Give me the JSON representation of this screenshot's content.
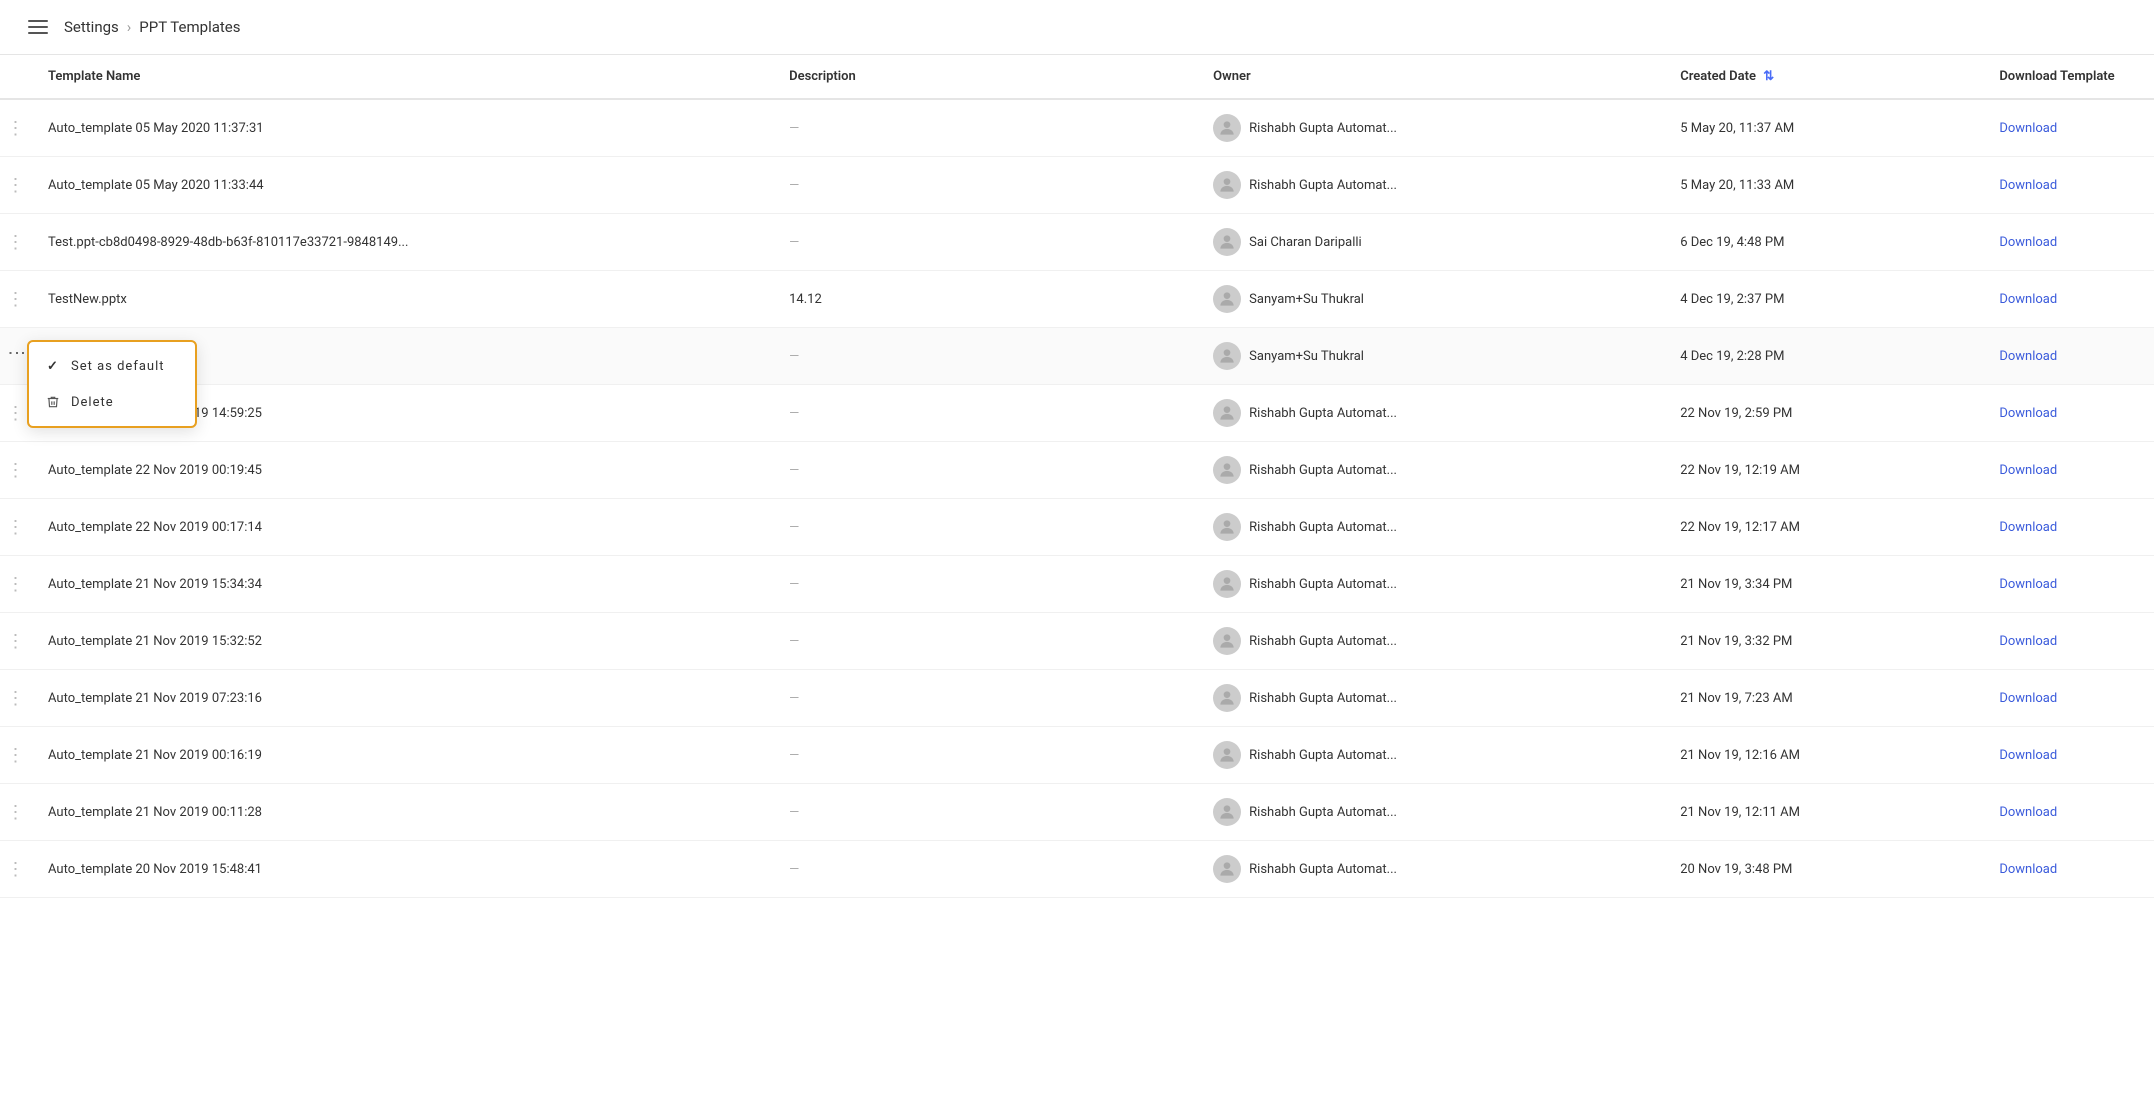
{
  "header": {
    "menu_icon": "hamburger-icon",
    "breadcrumb": [
      {
        "label": "Settings",
        "path": "settings"
      },
      {
        "label": "PPT Templates",
        "path": "ppt-templates"
      }
    ]
  },
  "table": {
    "columns": [
      {
        "key": "menu",
        "label": ""
      },
      {
        "key": "name",
        "label": "Template Name"
      },
      {
        "key": "description",
        "label": "Description"
      },
      {
        "key": "owner",
        "label": "Owner"
      },
      {
        "key": "created_date",
        "label": "Created Date",
        "sortable": true
      },
      {
        "key": "download",
        "label": "Download Template"
      }
    ],
    "rows": [
      {
        "id": 1,
        "name": "Auto_template 05 May 2020 11:37:31",
        "description": "—",
        "owner": "Rishabh Gupta Automat...",
        "created_date": "5 May 20, 11:37 AM",
        "download": "Download"
      },
      {
        "id": 2,
        "name": "Auto_template 05 May 2020 11:33:44",
        "description": "—",
        "owner": "Rishabh Gupta Automat...",
        "created_date": "5 May 20, 11:33 AM",
        "download": "Download"
      },
      {
        "id": 3,
        "name": "Test.ppt-cb8d0498-8929-48db-b63f-810117e33721-9848149...",
        "description": "—",
        "owner": "Sai Charan Daripalli",
        "created_date": "6 Dec 19, 4:48 PM",
        "download": "Download"
      },
      {
        "id": 4,
        "name": "TestNew.pptx",
        "description": "14.12",
        "owner": "Sanyam+Su Thukral",
        "created_date": "4 Dec 19, 2:37 PM",
        "download": "Download"
      },
      {
        "id": 5,
        "name": "",
        "description": "—",
        "owner": "Sanyam+Su Thukral",
        "created_date": "4 Dec 19, 2:28 PM",
        "download": "Download",
        "has_context_menu": true
      },
      {
        "id": 6,
        "name": "Auto_template 22 Nov 2019 14:59:25",
        "description": "—",
        "owner": "Rishabh Gupta Automat...",
        "created_date": "22 Nov 19, 2:59 PM",
        "download": "Download"
      },
      {
        "id": 7,
        "name": "Auto_template 22 Nov 2019 00:19:45",
        "description": "—",
        "owner": "Rishabh Gupta Automat...",
        "created_date": "22 Nov 19, 12:19 AM",
        "download": "Download"
      },
      {
        "id": 8,
        "name": "Auto_template 22 Nov 2019 00:17:14",
        "description": "—",
        "owner": "Rishabh Gupta Automat...",
        "created_date": "22 Nov 19, 12:17 AM",
        "download": "Download"
      },
      {
        "id": 9,
        "name": "Auto_template 21 Nov 2019 15:34:34",
        "description": "—",
        "owner": "Rishabh Gupta Automat...",
        "created_date": "21 Nov 19, 3:34 PM",
        "download": "Download"
      },
      {
        "id": 10,
        "name": "Auto_template 21 Nov 2019 15:32:52",
        "description": "—",
        "owner": "Rishabh Gupta Automat...",
        "created_date": "21 Nov 19, 3:32 PM",
        "download": "Download"
      },
      {
        "id": 11,
        "name": "Auto_template 21 Nov 2019 07:23:16",
        "description": "—",
        "owner": "Rishabh Gupta Automat...",
        "created_date": "21 Nov 19, 7:23 AM",
        "download": "Download"
      },
      {
        "id": 12,
        "name": "Auto_template 21 Nov 2019 00:16:19",
        "description": "—",
        "owner": "Rishabh Gupta Automat...",
        "created_date": "21 Nov 19, 12:16 AM",
        "download": "Download"
      },
      {
        "id": 13,
        "name": "Auto_template 21 Nov 2019 00:11:28",
        "description": "—",
        "owner": "Rishabh Gupta Automat...",
        "created_date": "21 Nov 19, 12:11 AM",
        "download": "Download"
      },
      {
        "id": 14,
        "name": "Auto_template 20 Nov 2019 15:48:41",
        "description": "—",
        "owner": "Rishabh Gupta Automat...",
        "created_date": "20 Nov 19, 3:48 PM",
        "download": "Download"
      }
    ]
  },
  "context_menu": {
    "items": [
      {
        "label": "Set as default",
        "icon": "check-icon"
      },
      {
        "label": "Delete",
        "icon": "trash-icon"
      }
    ]
  },
  "colors": {
    "accent_blue": "#3b5bdb",
    "context_border": "#e8a020"
  }
}
